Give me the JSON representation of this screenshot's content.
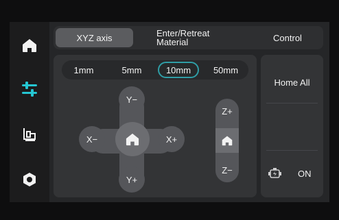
{
  "sidebar": {
    "items": [
      {
        "icon": "home-icon",
        "active": false
      },
      {
        "icon": "sliders-icon",
        "active": true
      },
      {
        "icon": "filament-icon",
        "active": false
      },
      {
        "icon": "hexnut-icon",
        "active": false
      }
    ],
    "accent_color": "#25c6d2"
  },
  "tabs": [
    {
      "label": "XYZ axis",
      "active": true
    },
    {
      "label": "Enter/Retreat\nMaterial",
      "active": false
    },
    {
      "label": "Control",
      "active": false
    }
  ],
  "step_sizes": {
    "options": [
      "1mm",
      "5mm",
      "10mm",
      "50mm"
    ],
    "selected": "10mm"
  },
  "jog": {
    "y_minus": "Y−",
    "y_plus": "Y+",
    "x_minus": "X−",
    "x_plus": "X+",
    "home_icon": "home-icon"
  },
  "z_axis": {
    "z_plus": "Z+",
    "z_minus": "Z−",
    "home_icon": "home-icon"
  },
  "control": {
    "home_all": "Home All",
    "motor_icon": "motor-icon",
    "motor_state": "ON"
  }
}
